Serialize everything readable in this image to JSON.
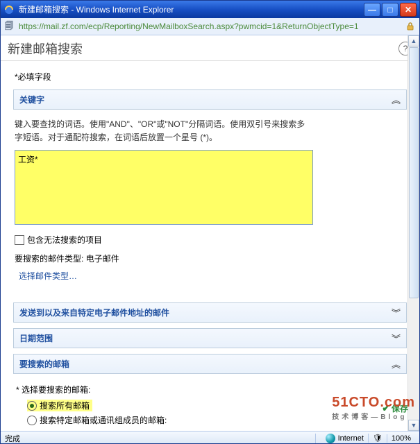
{
  "window": {
    "title": "新建邮箱搜索 - Windows Internet Explorer",
    "url": "https://mail.zf.com/ecp/Reporting/NewMailboxSearch.aspx?pwmcid=1&ReturnObjectType=1"
  },
  "page": {
    "heading": "新建邮箱搜索",
    "required_note": "*必填字段",
    "help_icon": "?"
  },
  "keywords": {
    "title": "关键字",
    "help": "键入要查找的词语。使用\"AND\"、\"OR\"或\"NOT\"分隔词语。使用双引号来搜索多字短语。对于通配符搜索，在词语后放置一个星号 (*)。",
    "value": "工资*",
    "include_unsearchable": "包含无法搜索的项目",
    "types_label": "要搜索的邮件类型:",
    "types_value": "电子邮件",
    "select_types": "选择邮件类型…"
  },
  "sections": {
    "sendto": "发送到以及来自特定电子邮件地址的邮件",
    "daterange": "日期范围",
    "mailboxes": "要搜索的邮箱"
  },
  "mailboxes": {
    "select_label": "* 选择要搜索的邮箱:",
    "option_all": "搜索所有邮箱",
    "option_specific": "搜索特定邮箱或通讯组成员的邮箱:"
  },
  "footer": {
    "save": "保存",
    "status_done": "完成",
    "status_zone": "Internet",
    "status_zoom": "100%"
  },
  "watermark": {
    "line1": "51CTO.com",
    "line2": "技术博客—Blog"
  }
}
